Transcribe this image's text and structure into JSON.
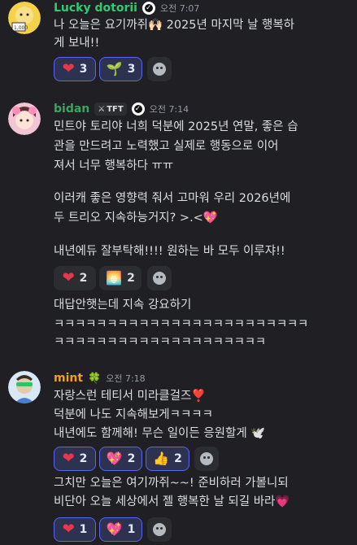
{
  "messages": [
    {
      "username": "Lucky dotorii",
      "name_color": "#2ecc71",
      "time": "오전 7:07",
      "lines": [
        "나 오늘은 요기까쥐🙌🏻 2025년 마지막 날 행복하",
        "게 보내!!"
      ],
      "reactions": [
        {
          "emoji": "heart-icon",
          "glyph": "❤",
          "count": "3",
          "active": true
        },
        {
          "emoji": "sprout-emoji",
          "glyph": "🌱",
          "count": "3",
          "active": true
        }
      ]
    },
    {
      "username": "bidan",
      "name_color": "#3ba55d",
      "tag": "TFT",
      "time": "오전 7:14",
      "lines": [
        "민트야 토리야 너희 덕분에 2025년 연말, 좋은 습",
        "관을 만드려고 노력했고 실제로 행동으로 이어",
        "져서 너무 행복하다 ㅠㅠ",
        "",
        "이러캐 좋은 영향력 줘서 고마워 우리 2026년에",
        "두 트리오 지속하능거지? >.<💖",
        "",
        "내년에듀 잘부탁해!!!! 원하는 바 모두 이루쟈!!"
      ],
      "reactions": [
        {
          "emoji": "heart-icon",
          "glyph": "❤",
          "count": "2",
          "active": false
        },
        {
          "emoji": "sunrise-emoji",
          "glyph": "🌅",
          "count": "2",
          "active": false
        }
      ],
      "followup_lines": [
        "대답안햇는데 지속 강요하기",
        "ㅋㅋㅋㅋㅋㅋㅋㅋㅋㅋㅋㅋㅋㅋㅋㅋㅋㅋㅋㅋㅋㅋㅋㅋ",
        "ㅋㅋㅋㅋㅋㅋㅋㅋㅋㅋㅋㅋㅋㅋㅋㅋㅋㅋㅋㅋ"
      ]
    },
    {
      "username": "mint",
      "name_color": "#f0a020",
      "suffix_emoji": "🍀",
      "time": "오전 7:18",
      "lines": [
        "자랑스런 테티서 미라클걸즈❣️",
        "덕분에 나도 지속해보게ㅋㅋㅋㅋ",
        "내년에도 함께해! 무슨 일이든 응원할게 🕊️"
      ],
      "reactions": [
        {
          "emoji": "heart-icon",
          "glyph": "❤",
          "count": "2",
          "active": true
        },
        {
          "emoji": "sparkling-heart-emoji",
          "glyph": "💖",
          "count": "2",
          "active": true
        },
        {
          "emoji": "thumbs-up-emoji",
          "glyph": "👍",
          "count": "2",
          "active": true
        }
      ],
      "followup_lines": [
        "그치만 오늘은 여기까쥐~~! 준비하러 가볼니되",
        "비단아 오늘 세상에서 젤 행복한 날 되길 바라💗"
      ],
      "followup_reactions": [
        {
          "emoji": "heart-icon",
          "glyph": "❤",
          "count": "1",
          "active": true
        },
        {
          "emoji": "sparkling-heart-emoji",
          "glyph": "💖",
          "count": "1",
          "active": true
        }
      ]
    }
  ]
}
